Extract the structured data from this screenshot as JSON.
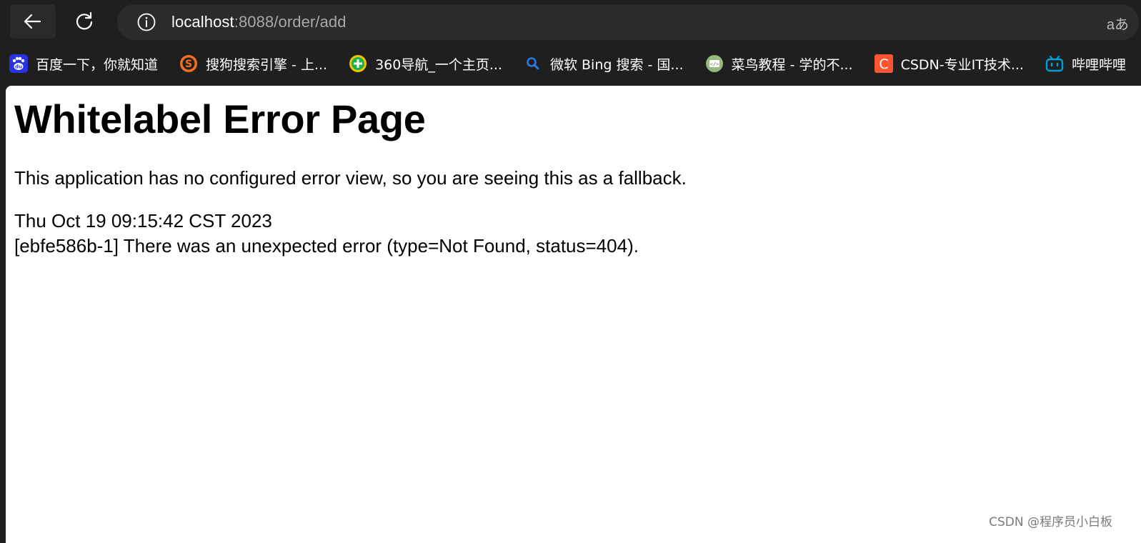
{
  "toolbar": {
    "back_icon": "arrow-left-icon",
    "reload_icon": "reload-icon",
    "site_info_icon": "info-circle-icon",
    "url_host": "localhost",
    "url_rest": ":8088/order/add",
    "read_aloud_label": "aあ"
  },
  "bookmarks": [
    {
      "label": "百度一下，你就知道",
      "icon": "baidu-icon",
      "color": "#2932e1"
    },
    {
      "label": "搜狗搜索引擎 - 上...",
      "icon": "sogou-icon",
      "color": "#f36f21"
    },
    {
      "label": "360导航_一个主页...",
      "icon": "360-icon",
      "color": "#1db14b"
    },
    {
      "label": "微软 Bing 搜索 - 国...",
      "icon": "search-icon",
      "color": "#2a7ae2"
    },
    {
      "label": "菜鸟教程 - 学的不...",
      "icon": "runoob-icon",
      "color": "#96b97d"
    },
    {
      "label": "CSDN-专业IT技术...",
      "icon": "csdn-icon",
      "color": "#fc5531"
    },
    {
      "label": "哔哩哔哩",
      "icon": "bilibili-icon",
      "color": "#00a1d6"
    }
  ],
  "page": {
    "title": "Whitelabel Error Page",
    "description": "This application has no configured error view, so you are seeing this as a fallback.",
    "timestamp": "Thu Oct 19 09:15:42 CST 2023",
    "error_message": "[ebfe586b-1] There was an unexpected error (type=Not Found, status=404)."
  },
  "watermark": "CSDN @程序员小白板"
}
